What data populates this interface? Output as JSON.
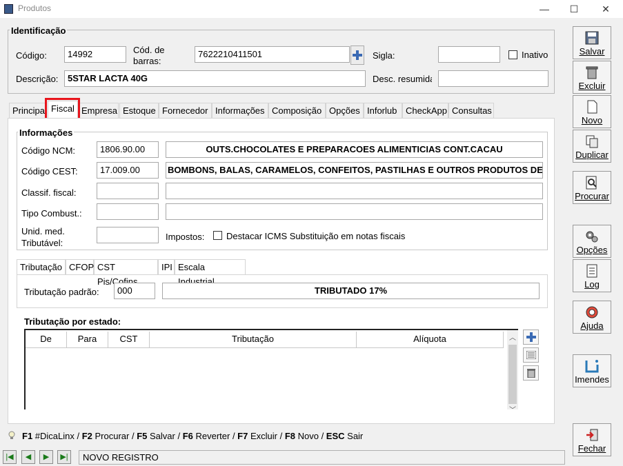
{
  "window": {
    "title": "Produtos",
    "minimize": "—",
    "maximize": "☐",
    "close": "✕"
  },
  "identificacao": {
    "title": "Identificação",
    "codigo_label": "Código:",
    "codigo_value": "14992",
    "cod_barras_label": "Cód. de barras:",
    "cod_barras_value": "7622210411501",
    "sigla_label": "Sigla:",
    "sigla_value": "",
    "inativo_label": "Inativo",
    "descricao_label": "Descrição:",
    "descricao_value": "5STAR LACTA 40G",
    "desc_resumida_label": "Desc. resumida",
    "desc_resumida_value": ""
  },
  "tabs": [
    "Principal",
    "Fiscal",
    "Empresa",
    "Estoque",
    "Fornecedor",
    "Informações",
    "Composição",
    "Opções",
    "Inforlub",
    "CheckApp",
    "Consultas"
  ],
  "active_tab": "Fiscal",
  "informacoes": {
    "title": "Informações",
    "ncm_label": "Código NCM:",
    "ncm_value": "1806.90.00",
    "ncm_desc": "OUTS.CHOCOLATES E PREPARACOES ALIMENTICIAS CONT.CACAU",
    "cest_label": "Código CEST:",
    "cest_value": "17.009.00",
    "cest_desc": "BOMBONS, BALAS, CARAMELOS, CONFEITOS, PASTILHAS E OUTROS PRODUTOS DE CONFEITARIA",
    "classif_label": "Classif. fiscal:",
    "tipo_comb_label": "Tipo Combust.:",
    "unid_label_1": "Unid. med.",
    "unid_label_2": "Tributável:",
    "impostos_label": "Impostos:",
    "destacar_label": "Destacar ICMS Substituição em notas fiscais"
  },
  "subtabs": [
    "Tributação",
    "CFOP",
    "CST Pis/Cofins",
    "IPI",
    "Escala Industrial"
  ],
  "tributacao": {
    "padrao_label": "Tributação padrão:",
    "padrao_code": "000",
    "padrao_desc": "TRIBUTADO 17%",
    "por_estado_label": "Tributação por estado:",
    "columns": [
      "De",
      "Para",
      "CST",
      "Tributação",
      "Alíquota"
    ]
  },
  "sidebar": [
    {
      "label": "Salvar",
      "icon": "save-icon"
    },
    {
      "label": "Excluir",
      "icon": "trash-icon"
    },
    {
      "label": "Novo",
      "icon": "new-document-icon"
    },
    {
      "label": "Duplicar",
      "icon": "duplicate-icon"
    },
    {
      "label": "Procurar",
      "icon": "search-icon"
    },
    {
      "label": "Opções",
      "icon": "gears-icon"
    },
    {
      "label": "Log",
      "icon": "log-icon"
    },
    {
      "label": "Ajuda",
      "icon": "lifebuoy-icon"
    },
    {
      "label": "Imendes",
      "icon": "imendes-icon"
    },
    {
      "label": "Fechar",
      "icon": "exit-icon"
    }
  ],
  "shortcuts": [
    {
      "key": "F1",
      "text": " #DicaLinx"
    },
    {
      "key": "F2",
      "text": " Procurar"
    },
    {
      "key": "F5",
      "text": " Salvar"
    },
    {
      "key": "F6",
      "text": " Reverter"
    },
    {
      "key": "F7",
      "text": " Excluir"
    },
    {
      "key": "F8",
      "text": " Novo"
    },
    {
      "key": "ESC",
      "text": " Sair"
    }
  ],
  "status": "NOVO REGISTRO",
  "colors": {
    "highlight": "#e8141c",
    "accent": "#1a7a1a"
  }
}
